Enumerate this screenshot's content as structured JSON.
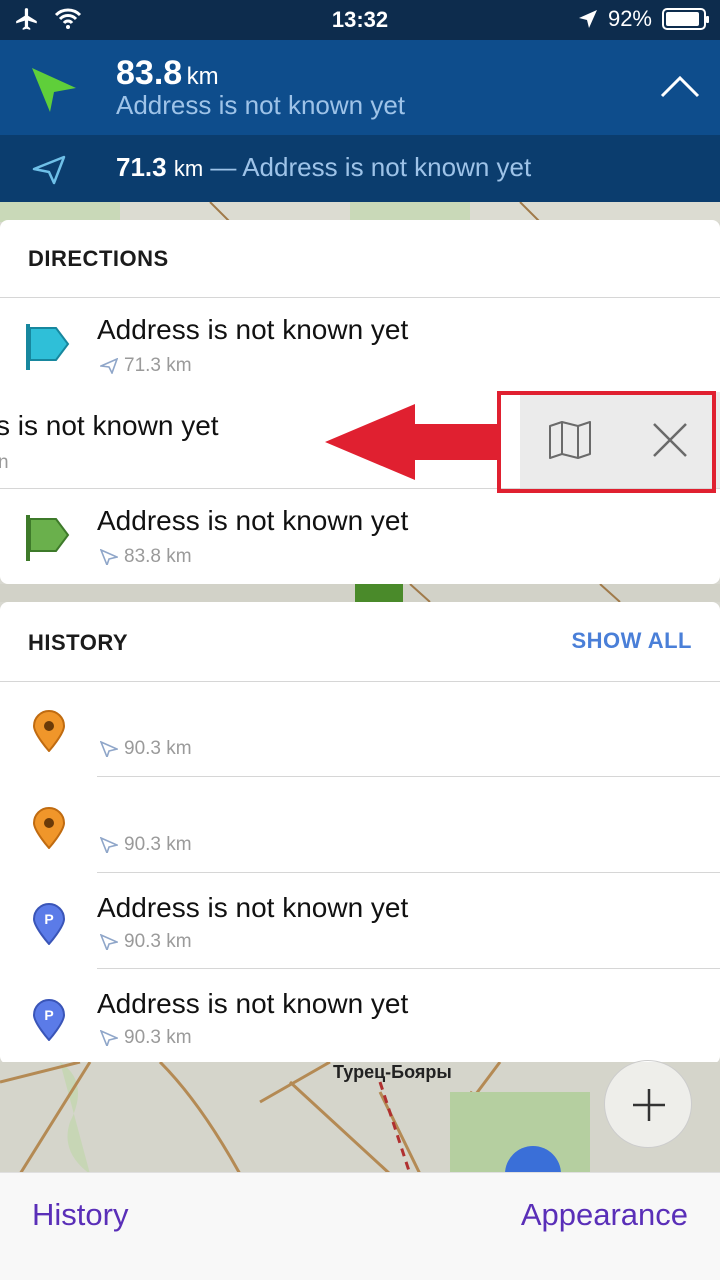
{
  "status_bar": {
    "time": "13:32",
    "battery": "92%",
    "battery_level": 0.92
  },
  "navigation": {
    "distance_value": "83.8",
    "distance_unit": "km",
    "address": "Address is not known yet",
    "next_distance_value": "71.3",
    "next_distance_unit": "km",
    "next_separator": "—",
    "next_address": "Address is not known yet"
  },
  "directions": {
    "title": "DIRECTIONS",
    "items": [
      {
        "title": "Address is not known yet",
        "distance": "71.3 km",
        "icon": "cyan-flag-icon"
      },
      {
        "title": "s is not known yet",
        "distance": "n",
        "icon": "none"
      },
      {
        "title": "Address is not known yet",
        "distance": "83.8 km",
        "icon": "green-flag-icon"
      }
    ]
  },
  "history": {
    "title": "HISTORY",
    "show_all": "SHOW ALL",
    "items": [
      {
        "title": "",
        "distance": "90.3 km",
        "icon": "orange-pin-icon"
      },
      {
        "title": "",
        "distance": "90.3 km",
        "icon": "orange-pin-icon"
      },
      {
        "title": "Address is not known yet",
        "distance": "90.3 km",
        "icon": "parking-pin-icon"
      },
      {
        "title": "Address is not known yet",
        "distance": "90.3 km",
        "icon": "parking-pin-icon"
      }
    ]
  },
  "map": {
    "place_label": "Турец-Бояры"
  },
  "tab_bar": {
    "left": "History",
    "right": "Appearance"
  },
  "colors": {
    "accent": "#5a2fb8",
    "header": "#0e4d8c",
    "link": "#4a7fd8",
    "highlight": "#e02030"
  }
}
